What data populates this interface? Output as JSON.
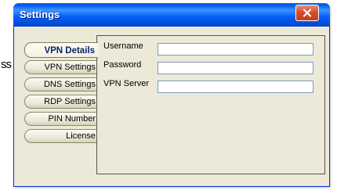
{
  "background": {
    "partial_text": "ss"
  },
  "window": {
    "title": "Settings",
    "close_glyph": "x"
  },
  "tabs": [
    {
      "label": "VPN Details",
      "active": true
    },
    {
      "label": "VPN Settings",
      "active": false
    },
    {
      "label": "DNS Settings",
      "active": false
    },
    {
      "label": "RDP Settings",
      "active": false
    },
    {
      "label": "PIN Number",
      "active": false
    },
    {
      "label": "License",
      "active": false
    }
  ],
  "form": {
    "username": {
      "label": "Username",
      "value": ""
    },
    "password": {
      "label": "Password",
      "value": ""
    },
    "vpn_server": {
      "label": "VPN Server",
      "value": ""
    }
  },
  "colors": {
    "titlebar": "#0058ee",
    "window_bg": "#ece9d8",
    "close_button": "#d6502f",
    "active_tab_text": "#0a246a"
  }
}
